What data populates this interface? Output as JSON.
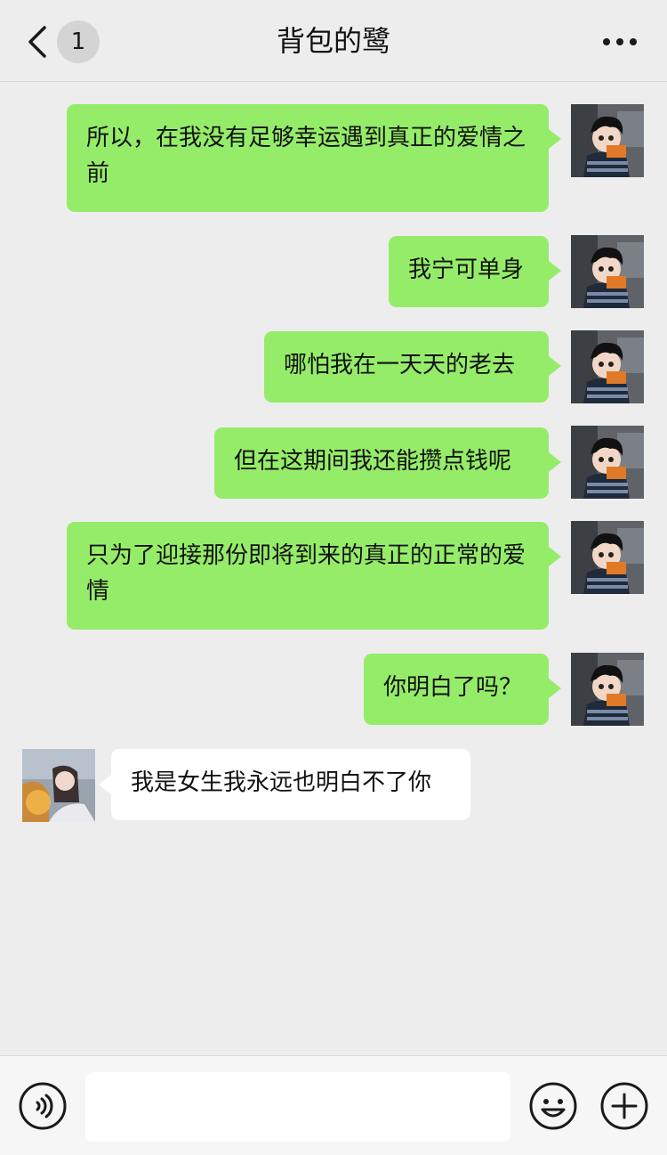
{
  "header": {
    "back_icon": "chevron-left-icon",
    "unread_count": "1",
    "title": "背包的鹭",
    "more_icon": "ellipsis-icon"
  },
  "messages": [
    {
      "side": "me",
      "text": "所以，在我没有足够幸运遇到真正的爱情之前"
    },
    {
      "side": "me",
      "text": "我宁可单身"
    },
    {
      "side": "me",
      "text": "哪怕我在一天天的老去"
    },
    {
      "side": "me",
      "text": "但在这期间我还能攒点钱呢"
    },
    {
      "side": "me",
      "text": "只为了迎接那份即将到来的真正的正常的爱情"
    },
    {
      "side": "me",
      "text": "你明白了吗？"
    },
    {
      "side": "other",
      "text": "我是女生我永远也明白不了你"
    }
  ],
  "input_bar": {
    "voice_icon": "voice-icon",
    "emoji_icon": "emoji-icon",
    "add_icon": "plus-icon",
    "input_value": ""
  },
  "colors": {
    "background": "#ededed",
    "my_bubble": "#95ec69",
    "their_bubble": "#ffffff"
  }
}
